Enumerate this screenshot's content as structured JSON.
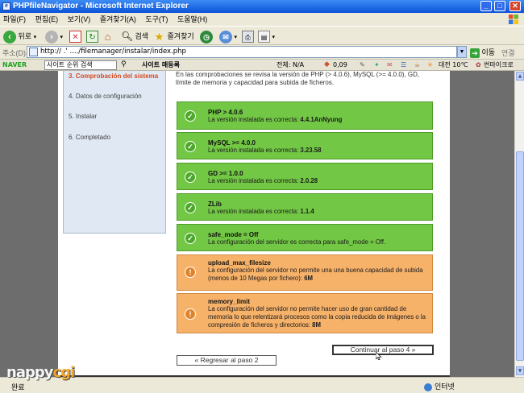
{
  "window": {
    "title": "PHPfileNavigator - Microsoft Internet Explorer",
    "min": "_",
    "max": "□",
    "close": "✕"
  },
  "menu": [
    "파일(F)",
    "편집(E)",
    "보기(V)",
    "즐겨찾기(A)",
    "도구(T)",
    "도움말(H)"
  ],
  "toolbar": {
    "back_label": "뒤로",
    "search_label": "검색",
    "favorites_label": "즐겨찾기"
  },
  "address": {
    "label": "주소(D)",
    "url": "http://       .'             ..../filemanager/instalar/index.php",
    "go_label": "이동",
    "links_label": "연결"
  },
  "naver": {
    "brand": "NAVER",
    "search_placeholder": "사이트 순위 검색",
    "site_label": "사이트 매등록",
    "total_label": "전체: N/A",
    "score": "0,09",
    "weather": "대전 10℃",
    "extra": "썬마이크로"
  },
  "installer": {
    "intro": "En las comprobaciones se revisa la versión de PHP (> 4.0.6), MySQL (>= 4.0.0), GD, límite de memoria y capacidad para subida de ficheros.",
    "steps": [
      {
        "label": "3.  Comprobación del sistema",
        "active": true
      },
      {
        "label": "4.  Datos de configuración",
        "active": false
      },
      {
        "label": "5.  Instalar",
        "active": false
      },
      {
        "label": "6.  Completado",
        "active": false
      }
    ],
    "checks": [
      {
        "status": "ok",
        "name": "PHP > 4.0.6",
        "desc": "La versión instalada es correcta: ",
        "value": "4.4.1AnNyung"
      },
      {
        "status": "ok",
        "name": "MySQL >= 4.0.0",
        "desc": "La versión instalada es correcta: ",
        "value": "3.23.58"
      },
      {
        "status": "ok",
        "name": "GD >= 1.0.0",
        "desc": "La versión instalada es correcta: ",
        "value": "2.0.28"
      },
      {
        "status": "ok",
        "name": "ZLib",
        "desc": "La versión instalada es correcta: ",
        "value": "1.1.4"
      },
      {
        "status": "ok",
        "name": "safe_mode = Off",
        "desc": "La configuración del servidor es correcta para safe_mode = Off.",
        "value": ""
      },
      {
        "status": "warn",
        "name": "upload_max_filesize",
        "desc": "La configuración del servidor no permite una una buena capacidad de subida (menos de 10 Megas por fichero): ",
        "value": "6M"
      },
      {
        "status": "warn",
        "name": "memory_limit",
        "desc": "La configuración del servidor no permite hacer uso de gran cantidad de memoria lo que relentizará procesos como la copia reducida de imágenes o la compresión de ficheros y directorios: ",
        "value": "8M"
      }
    ],
    "back_button": "« Regresar al paso 2",
    "next_button": "Continuar al paso 4 »"
  },
  "status": {
    "text": "완료",
    "zone": "인터넷"
  },
  "watermark": {
    "part1": "nappy",
    "part2": "cgi"
  }
}
